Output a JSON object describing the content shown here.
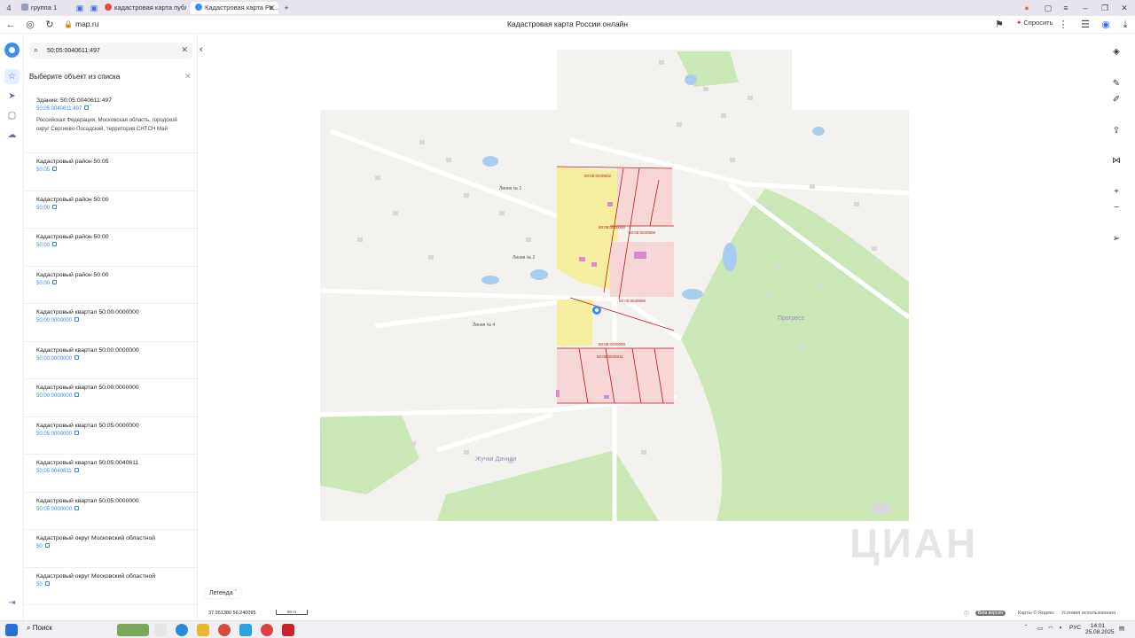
{
  "browser": {
    "tabs": [
      {
        "label": "группа 1"
      },
      {
        "label": "кадастровая карта публ..."
      },
      {
        "label": "Кадастровая карта Ро..."
      }
    ],
    "url": "map.ru",
    "page_title": "Кадастровая карта России онлайн",
    "ask_label": "Спросить"
  },
  "search": {
    "value": "50:05:0040611:497"
  },
  "panel": {
    "title": "Выберите объект из списка",
    "items": [
      {
        "title": "Здание: 50:05:0040611:497",
        "code": "50:05:0040611:497",
        "address": "Российская Федерация, Московская область, городской округ Сергиево-Посадский, территория СНТСН Май"
      },
      {
        "title": "Кадастровый район 50:05",
        "code": "50:05"
      },
      {
        "title": "Кадастровый район 50:00",
        "code": "50:00"
      },
      {
        "title": "Кадастровый район 50:00",
        "code": "50:00"
      },
      {
        "title": "Кадастровый район 50:00",
        "code": "50:00"
      },
      {
        "title": "Кадастровый квартал 50:00:0000000",
        "code": "50:00:0000000"
      },
      {
        "title": "Кадастровый квартал 50:00:0000000",
        "code": "50:00:0000000"
      },
      {
        "title": "Кадастровый квартал 50:00:0000000",
        "code": "50:00:0000000"
      },
      {
        "title": "Кадастровый квартал 50:05:0000000",
        "code": "50:05:0000000"
      },
      {
        "title": "Кадастровый квартал 50:05:0040611",
        "code": "50:05:0040611"
      },
      {
        "title": "Кадастровый квартал 50:05:0000000",
        "code": "50:05:0000000"
      },
      {
        "title": "Кадастровый округ Московский областной",
        "code": "50"
      },
      {
        "title": "Кадастровый округ Московский областной",
        "code": "50"
      }
    ]
  },
  "map": {
    "parcel_labels": [
      "50:05:0040602",
      "50:05:0000000",
      "50:05:0040606",
      "50:05:0040606",
      "50:05:0000000",
      "50:05:0040611"
    ],
    "street_labels": [
      "Линия № 1",
      "Линия № 2",
      "Линия № 4"
    ],
    "place_labels": [
      "Жучки Дачная",
      "Прогресс"
    ],
    "legend_label": "Легенда",
    "coords": "37.951380   56.240095",
    "scale_label": "50 m",
    "beta_label": "Beta версия",
    "copyright": "Карты © Яндекс",
    "terms": "Условия использования",
    "watermark": "ЦИАН",
    "accent": "#3d8df5",
    "parcel_color": "#f6d6d6",
    "selected_parcel_color": "#f5ef9f",
    "boundary_color": "#c2181e"
  },
  "taskbar": {
    "search_label": "Поиск",
    "lang": "РУС",
    "time": "14:01",
    "date": "25.08.2025"
  }
}
